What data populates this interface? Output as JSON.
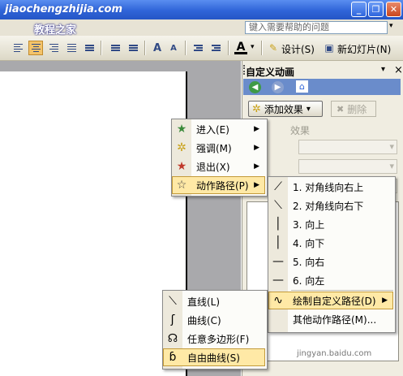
{
  "watermark": {
    "line1": "jiaochengzhijia.com",
    "line2": "教程之家"
  },
  "help": {
    "placeholder": "键入需要帮助的问题",
    "dropdown": "▾"
  },
  "window_buttons": {
    "minimize": "_",
    "restore": "❐",
    "close": "✕"
  },
  "toolbar": {
    "font_color_letter": "A",
    "dropdown": "▾",
    "design_label": "设计(S)",
    "new_slide_label": "新幻灯片(N)",
    "decrease_font": "A",
    "increase_font": "A"
  },
  "task_pane": {
    "title": "自定义动画",
    "drop": "▾",
    "close": "×",
    "back": "◀",
    "forward": "▶",
    "home": "⌂",
    "add_effect": "添加效果",
    "add_effect_arrow": "▾",
    "delete": "删除",
    "effect_header": "效果"
  },
  "menu_effects": [
    {
      "label": "进入(E)",
      "icon": "★",
      "color": "#3a8a3a",
      "arrow": "▶"
    },
    {
      "label": "强调(M)",
      "icon": "✲",
      "color": "#c9a21a",
      "arrow": "▶"
    },
    {
      "label": "退出(X)",
      "icon": "★",
      "color": "#c0392b",
      "arrow": "▶"
    },
    {
      "label": "动作路径(P)",
      "icon": "☆",
      "color": "#444444",
      "arrow": "▶"
    }
  ],
  "menu_paths": [
    {
      "label": "1. 对角线向右上",
      "icon": "⟋"
    },
    {
      "label": "2. 对角线向右下",
      "icon": "⟍"
    },
    {
      "label": "3. 向上",
      "icon": "│"
    },
    {
      "label": "4. 向下",
      "icon": "│"
    },
    {
      "label": "5. 向右",
      "icon": "—"
    },
    {
      "label": "6. 向左",
      "icon": "—"
    },
    {
      "label": "绘制自定义路径(D)",
      "icon": "∿",
      "arrow": "▶"
    },
    {
      "label": "其他动作路径(M)...",
      "icon": ""
    }
  ],
  "menu_draw": [
    {
      "label": "直线(L)",
      "icon": "⟍"
    },
    {
      "label": "曲线(C)",
      "icon": "ʃ"
    },
    {
      "label": "任意多边形(F)",
      "icon": "☊"
    },
    {
      "label": "自由曲线(S)",
      "icon": "ɓ"
    }
  ],
  "credit": "jingyan.baidu.com",
  "colors": {
    "highlight": "#ffe9a6",
    "title_blue": "#2f64d8",
    "nav_blue": "#6a8ccb"
  }
}
